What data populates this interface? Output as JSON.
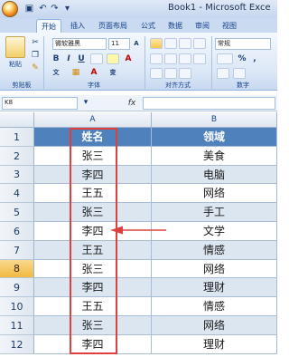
{
  "window": {
    "title": "Book1 - Microsoft Exce",
    "qat_icons": [
      "save-icon",
      "undo-icon",
      "redo-icon",
      "dropdown-icon"
    ]
  },
  "ribbon": {
    "tabs": [
      "开始",
      "插入",
      "页面布局",
      "公式",
      "数据",
      "审阅",
      "视图"
    ],
    "active_tab": "开始",
    "clipboard": {
      "paste_label": "粘贴",
      "group_label": "剪贴板"
    },
    "font": {
      "name": "微软雅黑",
      "size": "11",
      "group_label": "字体"
    },
    "alignment": {
      "group_label": "对齐方式"
    },
    "number": {
      "format": "常规",
      "group_label": "数字"
    }
  },
  "formula_bar": {
    "cell_ref": "K8",
    "fx_label": "fx",
    "content": ""
  },
  "grid": {
    "columns": [
      "A",
      "B"
    ],
    "selected_row": 8,
    "rows": [
      {
        "num": "1",
        "a": "姓名",
        "b": "领域"
      },
      {
        "num": "2",
        "a": "张三",
        "b": "美食"
      },
      {
        "num": "3",
        "a": "李四",
        "b": "电脑"
      },
      {
        "num": "4",
        "a": "王五",
        "b": "网络"
      },
      {
        "num": "5",
        "a": "张三",
        "b": "手工"
      },
      {
        "num": "6",
        "a": "李四",
        "b": "文学"
      },
      {
        "num": "7",
        "a": "王五",
        "b": "情感"
      },
      {
        "num": "8",
        "a": "张三",
        "b": "网络"
      },
      {
        "num": "9",
        "a": "李四",
        "b": "理财"
      },
      {
        "num": "10",
        "a": "王五",
        "b": "情感"
      },
      {
        "num": "11",
        "a": "张三",
        "b": "网络"
      },
      {
        "num": "12",
        "a": "李四",
        "b": "理财"
      }
    ]
  },
  "annotations": {
    "frame_color": "#e0403c",
    "arrow_color": "#e0403c"
  },
  "colors": {
    "header_fill": "#4f81bd",
    "band_fill": "#dce6f1",
    "selected_row_fill": "#f2b942"
  }
}
